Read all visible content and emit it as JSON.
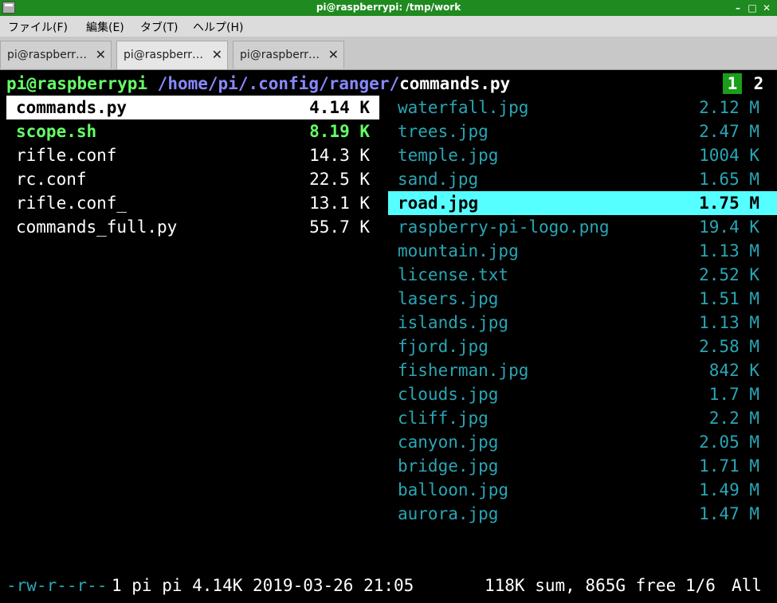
{
  "window": {
    "title": "pi@raspberrypi: /tmp/work"
  },
  "menu": [
    "ファイル(F)",
    "編集(E)",
    "タブ(T)",
    "ヘルプ(H)"
  ],
  "tabs": [
    {
      "label": "pi@raspberr…",
      "close": "✕"
    },
    {
      "label": "pi@raspberr…",
      "close": "✕"
    },
    {
      "label": "pi@raspberr…",
      "close": "✕"
    }
  ],
  "ranger": {
    "host": "pi@raspberrypi",
    "path": "/home/pi/.config/ranger/",
    "file": "commands.py",
    "tab_numbers": [
      "1",
      "2"
    ],
    "left_files": [
      {
        "name": "commands.py",
        "size": "4.14 K"
      },
      {
        "name": "scope.sh",
        "size": "8.19 K"
      },
      {
        "name": "rifle.conf",
        "size": "14.3 K"
      },
      {
        "name": "rc.conf",
        "size": "22.5 K"
      },
      {
        "name": "rifle.conf_",
        "size": "13.1 K"
      },
      {
        "name": "commands_full.py",
        "size": "55.7 K"
      }
    ],
    "right_files": [
      {
        "name": "waterfall.jpg",
        "size": "2.12 M"
      },
      {
        "name": "trees.jpg",
        "size": "2.47 M"
      },
      {
        "name": "temple.jpg",
        "size": "1004 K"
      },
      {
        "name": "sand.jpg",
        "size": "1.65 M"
      },
      {
        "name": "road.jpg",
        "size": "1.75 M"
      },
      {
        "name": "raspberry-pi-logo.png",
        "size": "19.4 K"
      },
      {
        "name": "mountain.jpg",
        "size": "1.13 M"
      },
      {
        "name": "license.txt",
        "size": "2.52 K"
      },
      {
        "name": "lasers.jpg",
        "size": "1.51 M"
      },
      {
        "name": "islands.jpg",
        "size": "1.13 M"
      },
      {
        "name": "fjord.jpg",
        "size": "2.58 M"
      },
      {
        "name": "fisherman.jpg",
        "size": "842 K"
      },
      {
        "name": "clouds.jpg",
        "size": "1.7 M"
      },
      {
        "name": "cliff.jpg",
        "size": "2.2 M"
      },
      {
        "name": "canyon.jpg",
        "size": "2.05 M"
      },
      {
        "name": "bridge.jpg",
        "size": "1.71 M"
      },
      {
        "name": "balloon.jpg",
        "size": "1.49 M"
      },
      {
        "name": "aurora.jpg",
        "size": "1.47 M"
      }
    ],
    "status": {
      "perms": "-rw-r--r--",
      "info": "1 pi pi 4.14K 2019-03-26 21:05",
      "summary": "118K sum, 865G free",
      "position": "1/6",
      "scroll": "All"
    }
  },
  "colors": {
    "titlebar": "#1f8a1f",
    "host": "#66ff66",
    "dir": "#8888ff",
    "image_file": "#2aa6b5",
    "exec_file": "#66ff66",
    "selected_bg_right": "#55ffff",
    "selected_bg_left": "#ffffff"
  }
}
